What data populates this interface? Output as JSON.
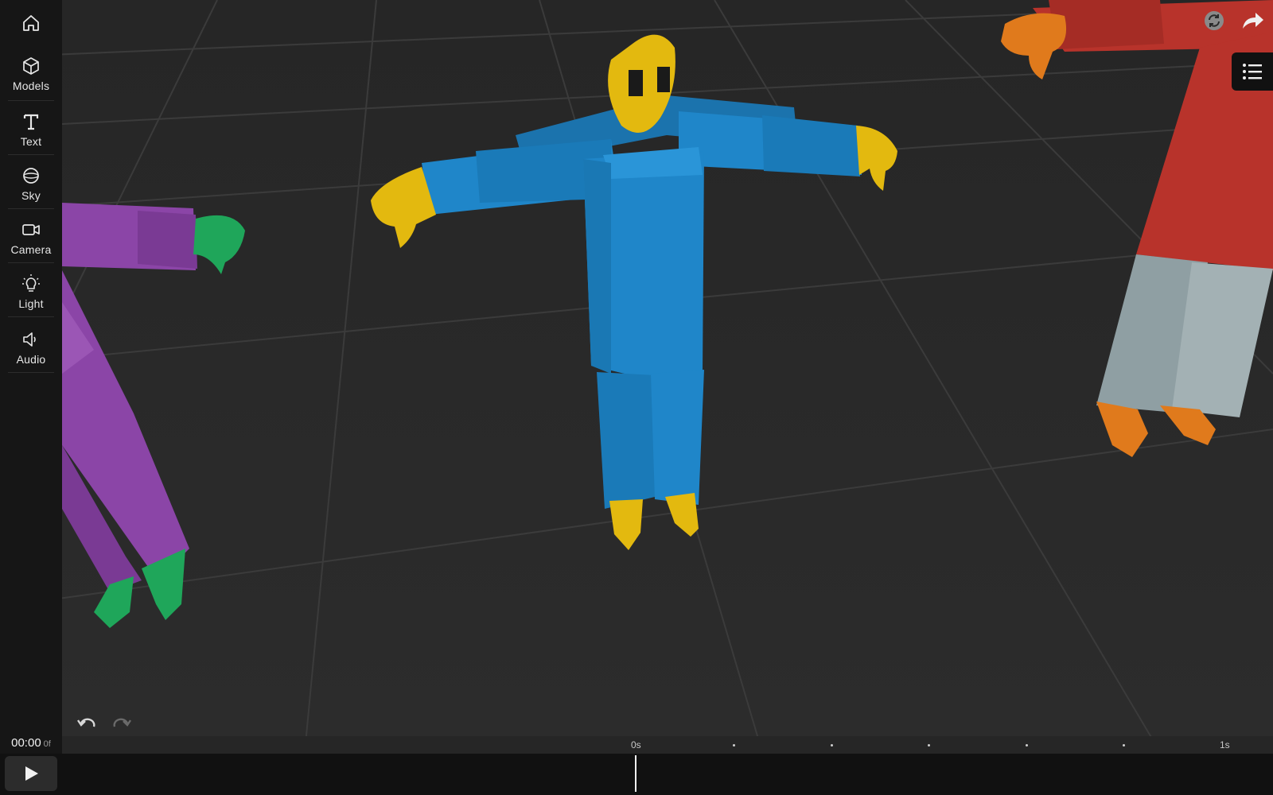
{
  "sidebar": {
    "items": [
      {
        "id": "home",
        "label": "",
        "icon": "home-icon"
      },
      {
        "id": "models",
        "label": "Models",
        "icon": "cube-icon"
      },
      {
        "id": "text",
        "label": "Text",
        "icon": "text-t-icon"
      },
      {
        "id": "sky",
        "label": "Sky",
        "icon": "sphere-icon"
      },
      {
        "id": "camera",
        "label": "Camera",
        "icon": "video-camera-icon"
      },
      {
        "id": "light",
        "label": "Light",
        "icon": "lightbulb-icon"
      },
      {
        "id": "audio",
        "label": "Audio",
        "icon": "speaker-icon"
      }
    ]
  },
  "toolbar": {
    "top_right_icons": [
      "sync-icon",
      "share-arrow-icon",
      "list-icon"
    ],
    "undo_icon": "undo-icon",
    "redo_icon": "redo-icon"
  },
  "timeline": {
    "timecode": "00:00",
    "frame": "0f",
    "ruler_start_label": "0s",
    "ruler_end_label": "1s",
    "play_icon": "play-icon"
  },
  "scene": {
    "characters": [
      {
        "name": "blue-character",
        "body_color": "#1f86c9",
        "accent_color": "#e3b90f"
      },
      {
        "name": "purple-character",
        "body_color": "#8b45a7",
        "accent_color": "#1fa65a"
      },
      {
        "name": "red-character",
        "body_color": "#b8332b",
        "accent_color": "#e07a1c",
        "legs_color": "#8f9fa3"
      }
    ],
    "floor_color": "#2a2a2a",
    "grid_color": "#3a3a3a"
  }
}
